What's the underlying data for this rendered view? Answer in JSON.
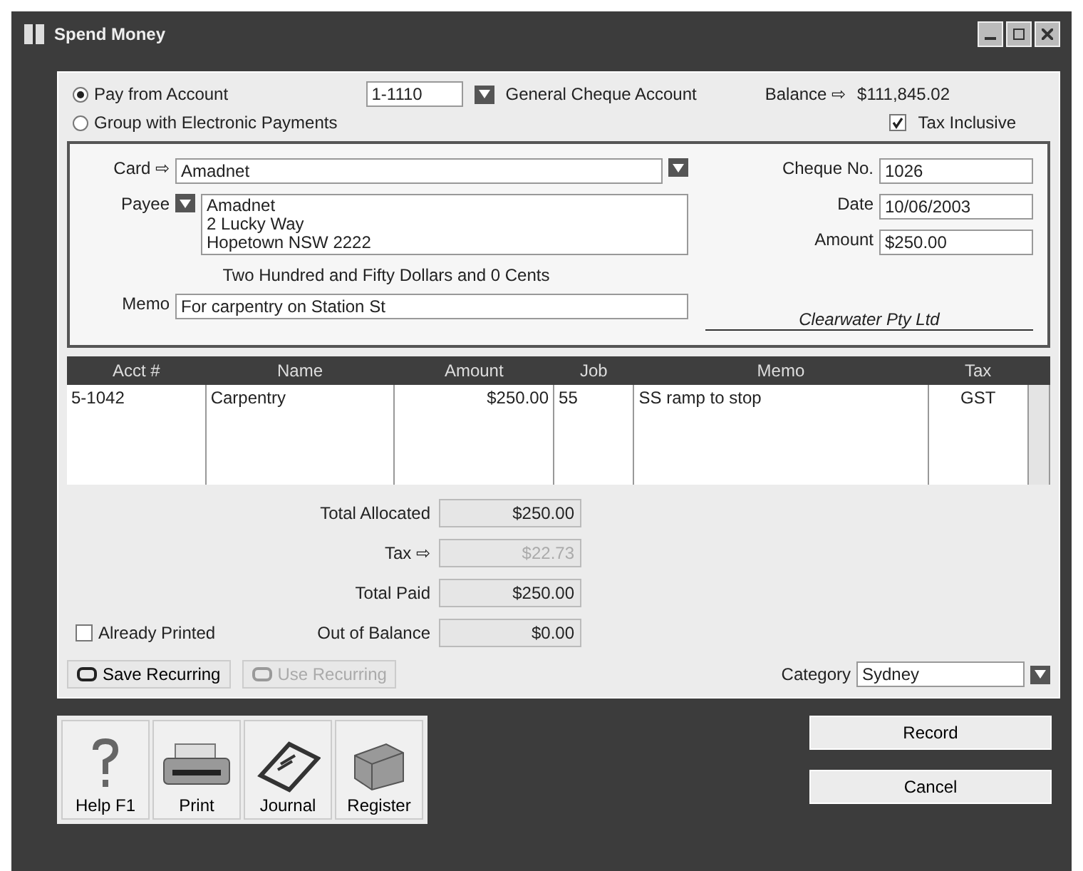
{
  "window": {
    "title": "Spend Money"
  },
  "pay_options": [
    {
      "label": "Pay from Account",
      "selected": true
    },
    {
      "label": "Group with Electronic Payments",
      "selected": false
    }
  ],
  "account": {
    "number": "1-1110",
    "name": "General Cheque Account"
  },
  "balance": {
    "label": "Balance ⇨",
    "value": "$111,845.02"
  },
  "tax_inclusive": {
    "label": "Tax Inclusive",
    "checked": true
  },
  "cheque": {
    "card_label": "Card ⇨",
    "card": "Amadnet",
    "payee_label": "Payee",
    "payee_lines": [
      "Amadnet",
      "2 Lucky Way",
      "Hopetown NSW 2222"
    ],
    "words": "Two Hundred and Fifty Dollars and 0 Cents",
    "memo_label": "Memo",
    "memo": "For carpentry on Station St",
    "cheque_no_label": "Cheque No.",
    "cheque_no": "1026",
    "date_label": "Date",
    "date": "10/06/2003",
    "amount_label": "Amount",
    "amount": "$250.00",
    "signature": "Clearwater Pty Ltd"
  },
  "table": {
    "columns": [
      "Acct #",
      "Name",
      "Amount",
      "Job",
      "Memo",
      "Tax"
    ],
    "rows": [
      {
        "cells": [
          "5-1042",
          "Carpentry",
          "$250.00",
          "55",
          "SS ramp to stop",
          "GST"
        ]
      }
    ]
  },
  "totals": [
    {
      "label": "Total Allocated",
      "value": "$250.00",
      "disabled": false
    },
    {
      "label": "Tax ⇨",
      "value": "$22.73",
      "disabled": true
    },
    {
      "label": "Total Paid",
      "value": "$250.00",
      "disabled": false
    },
    {
      "label": "Out of Balance",
      "value": "$0.00",
      "disabled": false
    }
  ],
  "already_printed": {
    "label": "Already Printed",
    "checked": false
  },
  "recurring_buttons": [
    {
      "label": "Save Recurring",
      "disabled": false
    },
    {
      "label": "Use Recurring",
      "disabled": true
    }
  ],
  "category": {
    "label": "Category",
    "value": "Sydney"
  },
  "toolbar": [
    {
      "label": "Help F1",
      "kind": "help"
    },
    {
      "label": "Print",
      "kind": "print"
    },
    {
      "label": "Journal",
      "kind": "journal"
    },
    {
      "label": "Register",
      "kind": "register"
    }
  ],
  "actions": [
    "Record",
    "Cancel"
  ]
}
